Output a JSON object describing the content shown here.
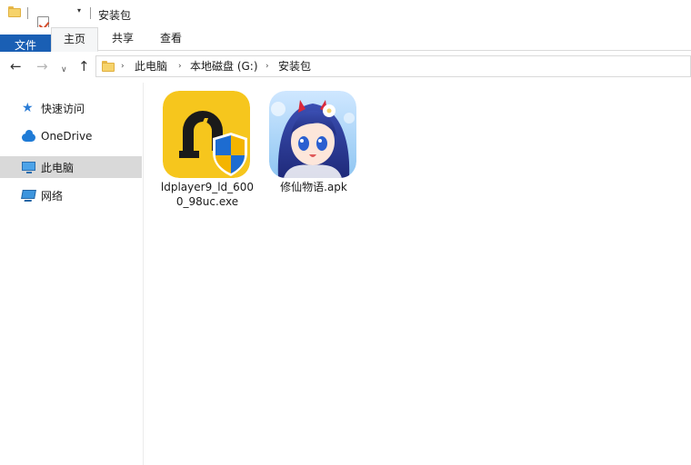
{
  "window": {
    "title": "安装包"
  },
  "quick_access_toolbar": {
    "icons": [
      "folder-icon",
      "properties-icon",
      "new-folder-icon",
      "customize-dropdown-icon"
    ]
  },
  "ribbon": {
    "tabs": [
      {
        "label": "文件",
        "active": false,
        "accent": "#1a5fb4"
      },
      {
        "label": "主页",
        "active": true
      },
      {
        "label": "共享",
        "active": false
      },
      {
        "label": "查看",
        "active": false
      }
    ]
  },
  "navigation": {
    "back": "←",
    "forward": "→",
    "recent": "∨",
    "up": "↑"
  },
  "address": {
    "separator": "›",
    "crumbs": [
      "此电脑",
      "本地磁盘 (G:)",
      "安装包"
    ]
  },
  "sidebar": {
    "items": [
      {
        "label": "快速访问",
        "icon": "quick-access-star-icon",
        "selected": false
      },
      {
        "label": "OneDrive",
        "icon": "onedrive-cloud-icon",
        "selected": false
      },
      {
        "label": "此电脑",
        "icon": "this-pc-icon",
        "selected": true
      },
      {
        "label": "网络",
        "icon": "network-icon",
        "selected": false
      }
    ]
  },
  "files": [
    {
      "name": "ldplayer9_ld_6000_98uc.exe",
      "icon": "ldplayer-app-icon"
    },
    {
      "name": "修仙物语.apk",
      "icon": "xiuxian-game-icon"
    }
  ]
}
